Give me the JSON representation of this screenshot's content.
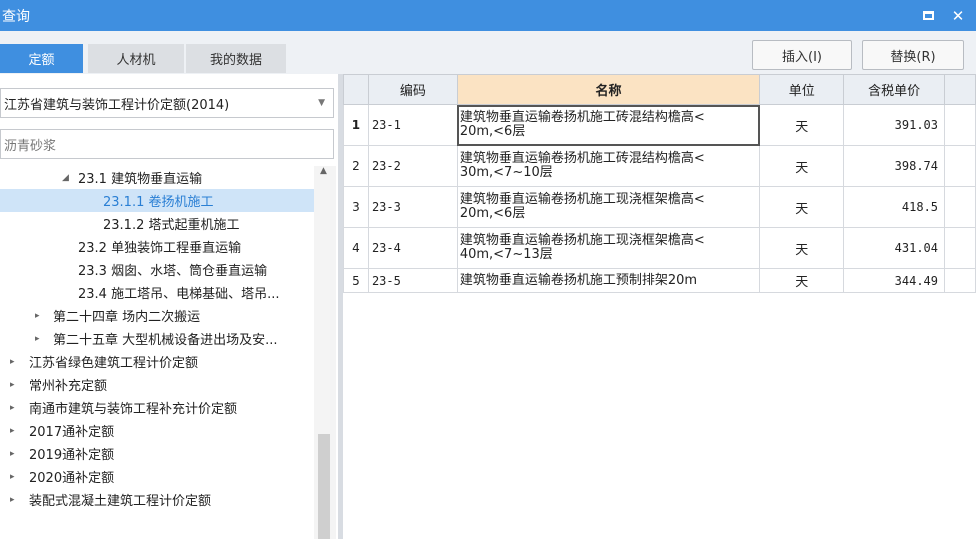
{
  "window": {
    "title": "查询"
  },
  "tabs": [
    {
      "label": "定额"
    },
    {
      "label": "人材机"
    },
    {
      "label": "我的数据"
    }
  ],
  "buttons": {
    "insert": "插入(I)",
    "replace": "替换(R)"
  },
  "library_select": {
    "value": "江苏省建筑与装饰工程计价定额(2014)"
  },
  "search": {
    "value": "沥青砂浆"
  },
  "tree": [
    {
      "label": "23.1 建筑物垂直运输",
      "toggle": "◢"
    },
    {
      "label": "23.1.1 卷扬机施工",
      "toggle": ""
    },
    {
      "label": "23.1.2 塔式起重机施工",
      "toggle": ""
    },
    {
      "label": "23.2 单独装饰工程垂直运输",
      "toggle": ""
    },
    {
      "label": "23.3 烟囱、水塔、筒仓垂直运输",
      "toggle": ""
    },
    {
      "label": "23.4 施工塔吊、电梯基础、塔吊...",
      "toggle": ""
    },
    {
      "label": "第二十四章 场内二次搬运",
      "toggle": "▸"
    },
    {
      "label": "第二十五章 大型机械设备进出场及安...",
      "toggle": "▸"
    },
    {
      "label": "江苏省绿色建筑工程计价定额",
      "toggle": "▸"
    },
    {
      "label": "常州补充定额",
      "toggle": "▸"
    },
    {
      "label": "南通市建筑与装饰工程补充计价定额",
      "toggle": "▸"
    },
    {
      "label": "2017通补定额",
      "toggle": "▸"
    },
    {
      "label": "2019通补定额",
      "toggle": "▸"
    },
    {
      "label": "2020通补定额",
      "toggle": "▸"
    },
    {
      "label": "装配式混凝土建筑工程计价定额",
      "toggle": "▸"
    }
  ],
  "table": {
    "headers": {
      "code": "编码",
      "name": "名称",
      "unit": "单位",
      "price": "含税单价"
    },
    "rows": [
      {
        "num": "1",
        "code": "23-1",
        "name_line1": "建筑物垂直运输卷扬机施工砖混结构檐高<",
        "name_line2": "20m,<6层",
        "unit": "天",
        "price": "391.03"
      },
      {
        "num": "2",
        "code": "23-2",
        "name_line1": "建筑物垂直运输卷扬机施工砖混结构檐高<",
        "name_line2": "30m,<7~10层",
        "unit": "天",
        "price": "398.74"
      },
      {
        "num": "3",
        "code": "23-3",
        "name_line1": "建筑物垂直运输卷扬机施工现浇框架檐高<",
        "name_line2": "20m,<6层",
        "unit": "天",
        "price": "418.5"
      },
      {
        "num": "4",
        "code": "23-4",
        "name_line1": "建筑物垂直运输卷扬机施工现浇框架檐高<",
        "name_line2": "40m,<7~13层",
        "unit": "天",
        "price": "431.04"
      },
      {
        "num": "5",
        "code": "23-5",
        "name_line1": "建筑物垂直运输卷扬机施工预制排架20m",
        "name_line2": "",
        "unit": "天",
        "price": "344.49"
      }
    ]
  }
}
